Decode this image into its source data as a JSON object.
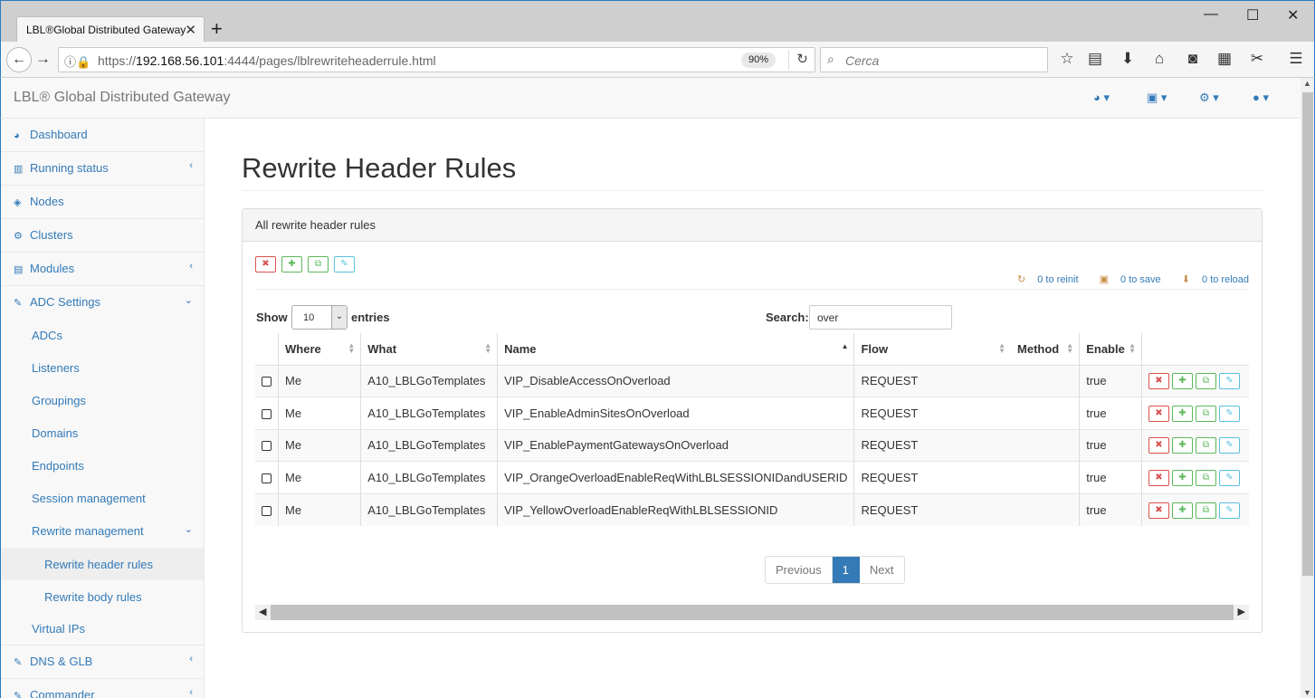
{
  "browser": {
    "tab_title": "LBL®Global Distributed Gateway",
    "url_prefix": "https://",
    "url_host": "192.168.56.101",
    "url_rest": ":4444/pages/lblrewriteheaderrule.html",
    "zoom": "90%",
    "search_placeholder": "Cerca"
  },
  "app": {
    "brand": "LBL® Global Distributed Gateway"
  },
  "sidebar": {
    "items": [
      {
        "label": "Dashboard",
        "icon": "dashboard-icon"
      },
      {
        "label": "Running status",
        "icon": "bar-chart-icon"
      },
      {
        "label": "Nodes",
        "icon": "cube-icon"
      },
      {
        "label": "Clusters",
        "icon": "cogs-icon"
      },
      {
        "label": "Modules",
        "icon": "list-icon"
      },
      {
        "label": "ADC Settings",
        "icon": "edit-icon"
      }
    ],
    "adc_sub": [
      "ADCs",
      "Listeners",
      "Groupings",
      "Domains",
      "Endpoints",
      "Session management",
      "Rewrite management"
    ],
    "rewrite_sub": [
      "Rewrite header rules",
      "Rewrite body rules"
    ],
    "virtual_ips": "Virtual IPs",
    "dns_glb": "DNS & GLB",
    "commander": "Commander"
  },
  "main": {
    "title": "Rewrite Header Rules",
    "panel_title": "All rewrite header rules",
    "counters": {
      "reinit": "0 to reinit",
      "save": "0 to save",
      "reload": "0 to reload"
    },
    "show_label": "Show",
    "entries_value": "10",
    "entries_label": "entries",
    "search_label": "Search:",
    "search_value": "over"
  },
  "table": {
    "columns": [
      "Where",
      "What",
      "Name",
      "Flow",
      "Method",
      "Enable"
    ],
    "rows": [
      {
        "where": "Me",
        "what": "A10_LBLGoTemplates",
        "name": "VIP_DisableAccessOnOverload",
        "flow": "REQUEST",
        "method": "",
        "enable": "true"
      },
      {
        "where": "Me",
        "what": "A10_LBLGoTemplates",
        "name": "VIP_EnableAdminSitesOnOverload",
        "flow": "REQUEST",
        "method": "",
        "enable": "true"
      },
      {
        "where": "Me",
        "what": "A10_LBLGoTemplates",
        "name": "VIP_EnablePaymentGatewaysOnOverload",
        "flow": "REQUEST",
        "method": "",
        "enable": "true"
      },
      {
        "where": "Me",
        "what": "A10_LBLGoTemplates",
        "name": "VIP_OrangeOverloadEnableReqWithLBLSESSIONIDandUSERID",
        "flow": "REQUEST",
        "method": "",
        "enable": "true"
      },
      {
        "where": "Me",
        "what": "A10_LBLGoTemplates",
        "name": "VIP_YellowOverloadEnableReqWithLBLSESSIONID",
        "flow": "REQUEST",
        "method": "",
        "enable": "true"
      }
    ]
  },
  "pagination": {
    "previous": "Previous",
    "current": "1",
    "next": "Next"
  }
}
